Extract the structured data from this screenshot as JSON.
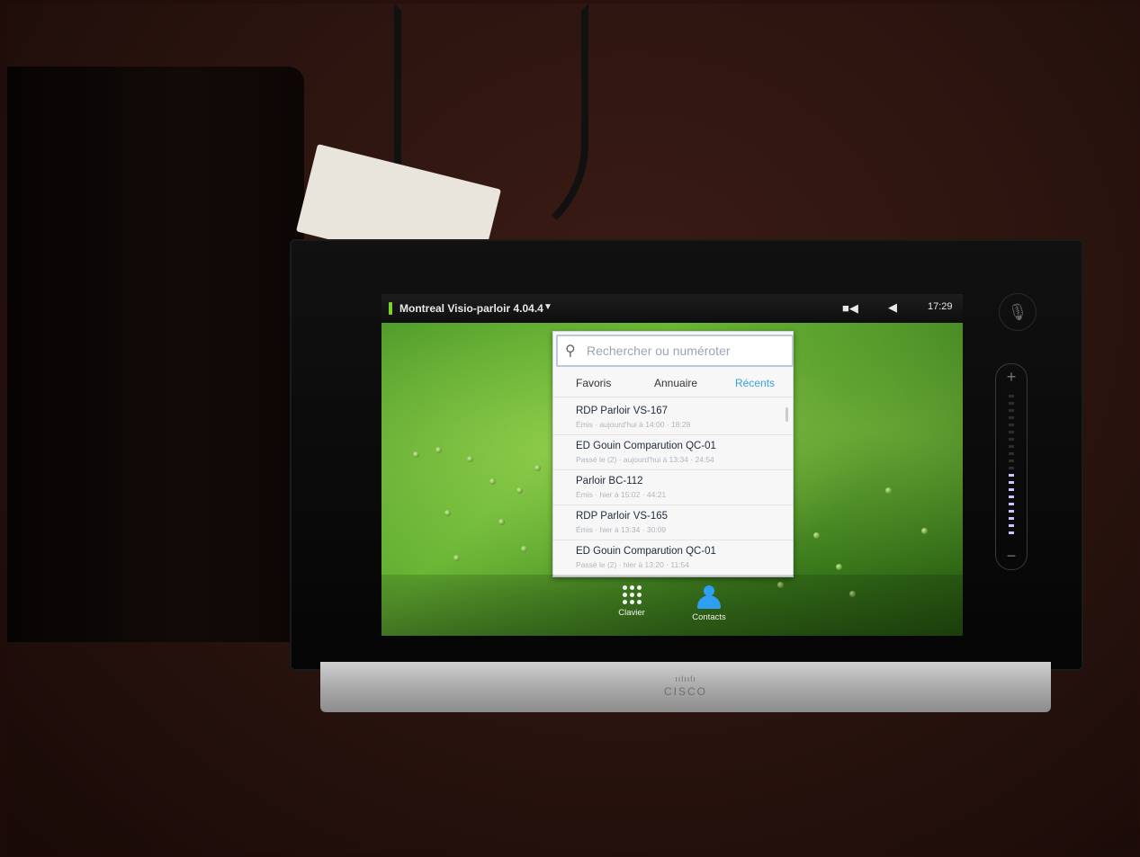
{
  "status_bar": {
    "title": "Montreal Visio-parloir 4.04.4",
    "title_arrow": "▼",
    "camera_icon": "video-camera-icon",
    "speaker_icon": "speaker-icon",
    "time": "17:29"
  },
  "search": {
    "placeholder": "Rechercher ou numéroter",
    "icon": "search-icon"
  },
  "tabs": [
    {
      "label": "Favoris",
      "active": false
    },
    {
      "label": "Annuaire",
      "active": false
    },
    {
      "label": "Récents",
      "active": true
    }
  ],
  "recents": [
    {
      "name": "RDP Parloir VS-167",
      "detail": "Émis · aujourd'hui à 14:00 · 18:28"
    },
    {
      "name": "ED Gouin Comparution QC-01",
      "detail": "Passé le (2) · aujourd'hui à 13:34 · 24:54"
    },
    {
      "name": "Parloir BC-112",
      "detail": "Émis · hier à 15:02 · 44:21"
    },
    {
      "name": "RDP Parloir VS-165",
      "detail": "Émis · hier à 13:34 · 30:09"
    },
    {
      "name": "ED Gouin Comparution QC-01",
      "detail": "Passé le (2) · hier à 13:20 · 11:54"
    }
  ],
  "dock": {
    "keypad_label": "Clavier",
    "contacts_label": "Contacts",
    "contacts_color": "#2e9ff2"
  },
  "hardware": {
    "mute_icon": "mic-mute-icon",
    "volume_plus": "+",
    "volume_minus": "−",
    "volume_level": 0.45,
    "brand": "CISCO",
    "brand_bars": "ıılıılı"
  },
  "colors": {
    "accent": "#3aa0e0",
    "online": "#7bd32e"
  }
}
